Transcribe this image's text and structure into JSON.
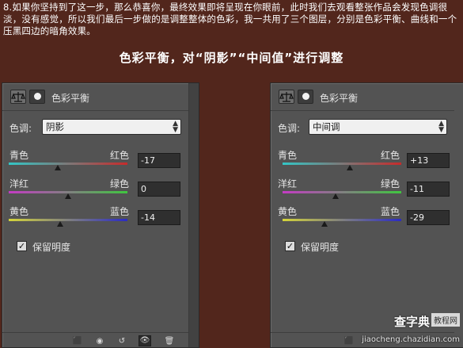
{
  "intro_text": "8.如果你坚持到了这一步，那么恭喜你，最终效果即将呈现在你眼前，此时我们去观看整张作品会发现色调很淡，没有感觉，所以我们最后一步做的是调整整体的色彩，我一共用了三个图层，分别是色彩平衡、曲线和一个压黑四边的暗角效果。",
  "heading": "色彩平衡，对“阴影”“中间值”进行调整",
  "panels": [
    {
      "title": "色彩平衡",
      "tone_label": "色调:",
      "tone_value": "阴影",
      "sliders": [
        {
          "left": "青色",
          "right": "红色",
          "value": "-17",
          "numeric": -17,
          "gradient": [
            "#33c6c6",
            "#c62b2b"
          ]
        },
        {
          "left": "洋红",
          "right": "绿色",
          "value": "0",
          "numeric": 0,
          "gradient": [
            "#c43bc4",
            "#3fc63f"
          ]
        },
        {
          "left": "黄色",
          "right": "蓝色",
          "value": "-14",
          "numeric": -14,
          "gradient": [
            "#d4d43a",
            "#2b2bc4"
          ]
        }
      ],
      "preserve_luminosity": "保留明度"
    },
    {
      "title": "色彩平衡",
      "tone_label": "色调:",
      "tone_value": "中间调",
      "sliders": [
        {
          "left": "青色",
          "right": "红色",
          "value": "+13",
          "numeric": 13,
          "gradient": [
            "#33c6c6",
            "#c62b2b"
          ]
        },
        {
          "left": "洋红",
          "right": "绿色",
          "value": "-11",
          "numeric": -11,
          "gradient": [
            "#c43bc4",
            "#3fc63f"
          ]
        },
        {
          "left": "黄色",
          "right": "蓝色",
          "value": "-29",
          "numeric": -29,
          "gradient": [
            "#d4d43a",
            "#2b2bc4"
          ]
        }
      ],
      "preserve_luminosity": "保留明度"
    }
  ],
  "watermark": {
    "site": "查字典",
    "tag": "教程网",
    "url": "jiaocheng.chazidian.com"
  }
}
